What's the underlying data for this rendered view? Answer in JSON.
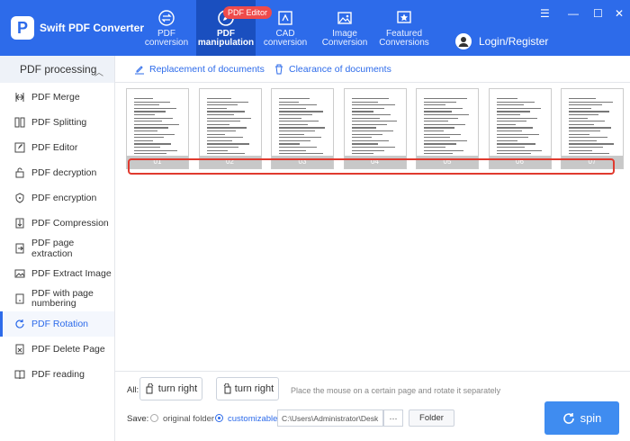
{
  "app": {
    "title": "Swift PDF Converter",
    "logo_letter": "P"
  },
  "nav": {
    "items": [
      {
        "label": "PDF\nconversion",
        "icon": "swap-icon"
      },
      {
        "label": "PDF\nmanipulation",
        "icon": "edit-cycle-icon",
        "badge": "PDF Editor",
        "active": true
      },
      {
        "label": "CAD\nconversion",
        "icon": "cad-icon"
      },
      {
        "label": "Image\nConversion",
        "icon": "image-icon"
      },
      {
        "label": "Featured\nConversions",
        "icon": "star-icon"
      }
    ],
    "login": "Login/Register"
  },
  "sidebar": {
    "heading": "PDF processing",
    "items": [
      {
        "label": "PDF Merge"
      },
      {
        "label": "PDF Splitting"
      },
      {
        "label": "PDF Editor"
      },
      {
        "label": "PDF decryption"
      },
      {
        "label": "PDF encryption"
      },
      {
        "label": "PDF Compression"
      },
      {
        "label": "PDF page extraction"
      },
      {
        "label": "PDF Extract Image"
      },
      {
        "label": "PDF with page numbering"
      },
      {
        "label": "PDF Rotation",
        "active": true
      },
      {
        "label": "PDF Delete Page"
      },
      {
        "label": "PDF reading"
      }
    ]
  },
  "toolbar": {
    "replace_label": "Replacement of documents",
    "clear_label": "Clearance of documents"
  },
  "pages": [
    "01",
    "02",
    "03",
    "04",
    "05",
    "06",
    "07"
  ],
  "bottom": {
    "all_label": "All:",
    "turn_right_1": "turn right",
    "turn_right_2": "turn right",
    "hint": "Place the mouse on a certain page and rotate it separately",
    "save_label": "Save:",
    "option_original": "original folder",
    "option_custom": "customizable",
    "path_value": "C:\\Users\\Administrator\\Desk...",
    "dots": "···",
    "folder_label": "Folder",
    "spin_label": "spin"
  },
  "colors": {
    "accent": "#2d6bea",
    "header": "#2d6bea",
    "spin": "#3f8cf0",
    "highlight": "#e03a2f"
  }
}
